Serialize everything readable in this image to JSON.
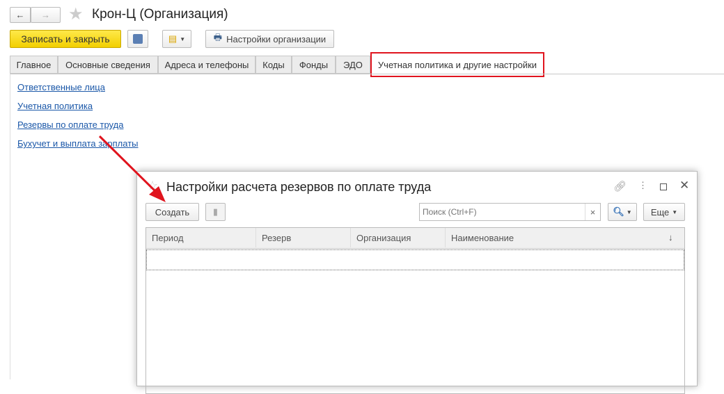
{
  "window": {
    "title": "Крон-Ц (Организация)"
  },
  "toolbar": {
    "save_close": "Записать и закрыть",
    "org_settings": "Настройки организации"
  },
  "tabs": [
    "Главное",
    "Основные сведения",
    "Адреса и телефоны",
    "Коды",
    "Фонды",
    "ЭДО",
    "Учетная политика и другие настройки"
  ],
  "links": [
    "Ответственные лица",
    "Учетная политика",
    "Резервы по оплате труда",
    "Бухучет и выплата зарплаты"
  ],
  "dialog": {
    "title": "Настройки расчета резервов по оплате труда",
    "create": "Создать",
    "search_placeholder": "Поиск (Ctrl+F)",
    "clear": "×",
    "more": "Еще",
    "columns": [
      "Период",
      "Резерв",
      "Организация",
      "Наименование"
    ],
    "sort_indicator": "↓"
  },
  "colors": {
    "accent": "#f5d800",
    "highlight": "#e0141e",
    "link": "#1a57a8"
  }
}
